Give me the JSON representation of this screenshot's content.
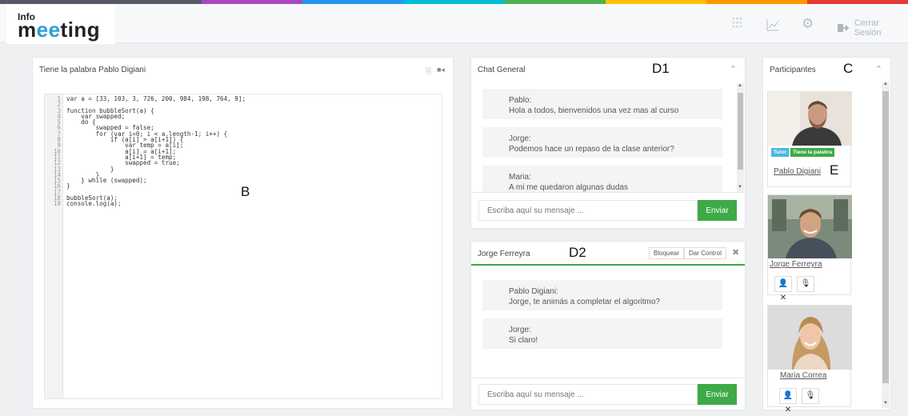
{
  "colors": {
    "accent_green": "#3daa47",
    "accent_blue": "#2e9fd6",
    "badge_blue": "#4bb8e0",
    "top_strip": [
      "#555a66",
      "#ab47bc",
      "#2196f3",
      "#00bcd4",
      "#4caf50",
      "#ffc107",
      "#ff9800",
      "#e53935"
    ]
  },
  "header": {
    "logo_top": "Info",
    "logo_main_pre": "m",
    "logo_main_oo": "ee",
    "logo_main_post": "ting",
    "icons": [
      "apps-grid-icon",
      "chart-icon",
      "gear-icon"
    ],
    "logout_label": "Cerrar Sesión"
  },
  "editor_panel": {
    "title": "Tiene la palabra Pablo Digiani",
    "tag": "B",
    "code_lines": [
      "var a = [33, 103, 3, 726, 200, 984, 198, 764, 9];",
      "",
      "function bubbleSort(a) {",
      "    var swapped;",
      "    do {",
      "        swapped = false;",
      "        for (var i=0; i < a.length-1; i++) {",
      "            if (a[i] > a[i+1]) {",
      "                var temp = a[i];",
      "                a[i] = a[i+1];",
      "                a[i+1] = temp;",
      "                swapped = true;",
      "            }",
      "        }",
      "    } while (swapped);",
      "}",
      "",
      "bubbleSort(a);",
      "console.log(a);"
    ]
  },
  "chat_general": {
    "title": "Chat General",
    "tag": "D1",
    "messages": [
      {
        "author": "Pablo:",
        "text": "Hola a todos, bienvenidos una vez mas al curso"
      },
      {
        "author": "Jorge:",
        "text": "Podemos hace un repaso de la clase anterior?"
      },
      {
        "author": "Maria:",
        "text": "A mi me quedaron algunas dudas"
      }
    ],
    "input_placeholder": "Escriba aquí su mensaje ...",
    "send_label": "Enviar"
  },
  "private_chat": {
    "title": "Jorge Ferreyra",
    "tag": "D2",
    "block_label": "Bloquear",
    "control_label": "Dar Control",
    "close_icon": "close-icon",
    "messages": [
      {
        "author": "Pablo Digiani:",
        "text": "Jorge, te animás a completar el algoritmo?"
      },
      {
        "author": "Jorge:",
        "text": "Si claro!"
      }
    ],
    "input_placeholder": "Escriba aquí su mensaje ...",
    "send_label": "Enviar"
  },
  "participants": {
    "title": "Participantes",
    "tag": "C",
    "people": [
      {
        "name": "Pablo Digiani",
        "badges": [
          "Tutor",
          "Tiene la palabra"
        ],
        "tag": "E"
      },
      {
        "name": "Jorge Ferreyra"
      },
      {
        "name": "Maria Correa"
      }
    ]
  }
}
